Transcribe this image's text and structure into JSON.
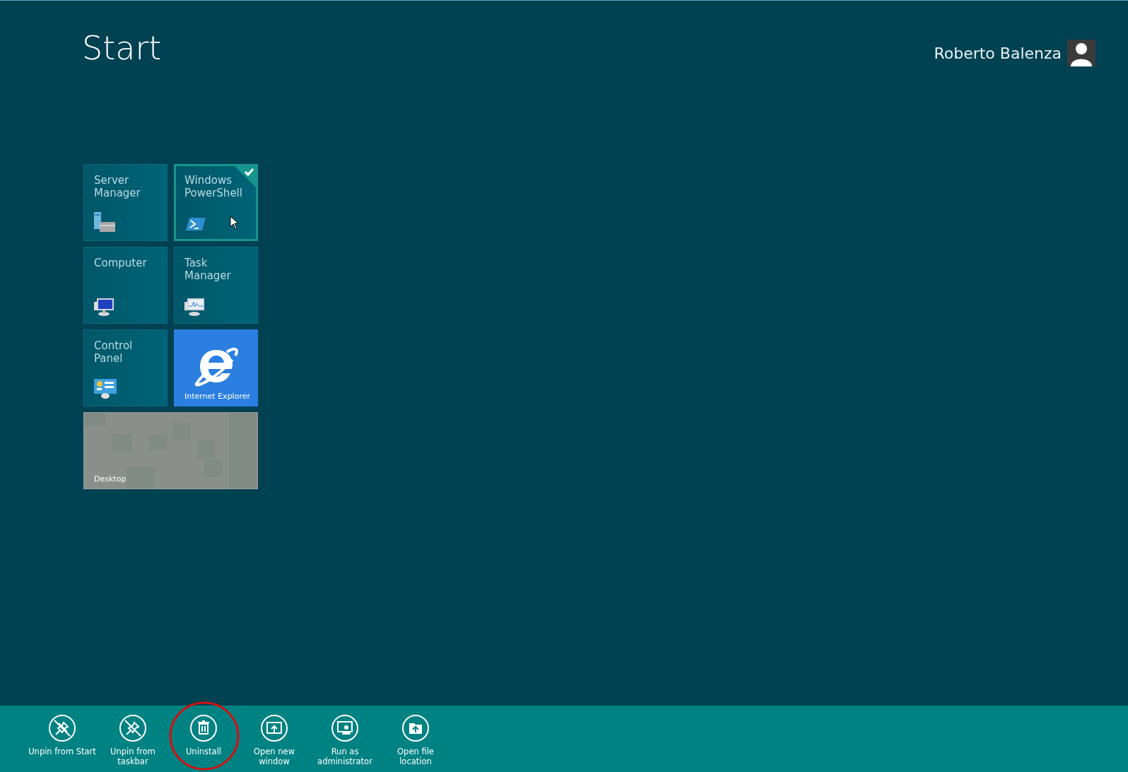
{
  "header": {
    "title": "Start",
    "user_name": "Roberto Balenza"
  },
  "tiles": [
    {
      "label": "Server Manager",
      "kind": "small",
      "selected": false
    },
    {
      "label": "Windows PowerShell",
      "kind": "small",
      "selected": true
    },
    {
      "label": "Computer",
      "kind": "small",
      "selected": false
    },
    {
      "label": "Task Manager",
      "kind": "small",
      "selected": false
    },
    {
      "label": "Control Panel",
      "kind": "small",
      "selected": false
    },
    {
      "label": "Internet Explorer",
      "kind": "branded",
      "selected": false
    },
    {
      "label": "Desktop",
      "kind": "wide",
      "selected": false
    }
  ],
  "app_bar": [
    {
      "label": "Unpin from Start",
      "highlighted": false
    },
    {
      "label": "Unpin from taskbar",
      "highlighted": false
    },
    {
      "label": "Uninstall",
      "highlighted": true
    },
    {
      "label": "Open new window",
      "highlighted": false
    },
    {
      "label": "Run as administrator",
      "highlighted": false
    },
    {
      "label": "Open file location",
      "highlighted": false
    }
  ]
}
